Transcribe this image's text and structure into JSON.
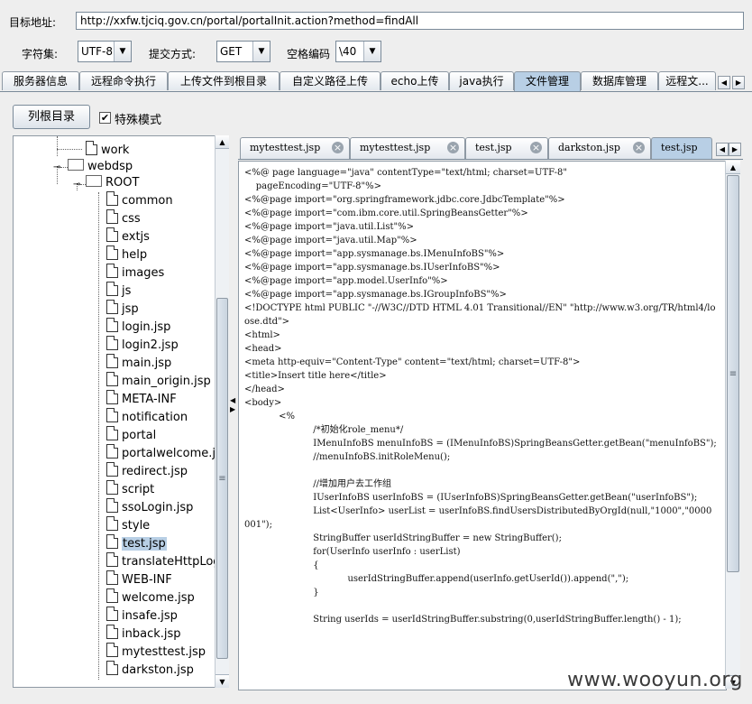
{
  "form": {
    "url_label": "目标地址:",
    "url_value": "http://xxfw.tjciq.gov.cn/portal/portalInit.action?method=findAll",
    "charset_label": "字符集:",
    "charset_value": "UTF-8",
    "submit_label": "提交方式:",
    "submit_value": "GET",
    "space_label": "空格编码",
    "space_value": "\\40"
  },
  "main_tabs": [
    {
      "label": "服务器信息"
    },
    {
      "label": "远程命令执行"
    },
    {
      "label": "上传文件到根目录"
    },
    {
      "label": "自定义路径上传"
    },
    {
      "label": "echo上传"
    },
    {
      "label": "java执行"
    },
    {
      "label": "文件管理"
    },
    {
      "label": "数据库管理"
    },
    {
      "label": "远程文..."
    }
  ],
  "toolbar": {
    "list_root_label": "列根目录",
    "special_mode_label": "特殊模式",
    "special_mode_checked": true
  },
  "tree": {
    "nodes": [
      {
        "label": "work",
        "type": "file"
      },
      {
        "label": "webdsp",
        "type": "folder"
      },
      {
        "label": "ROOT",
        "type": "folder"
      },
      {
        "label": "common",
        "type": "file"
      },
      {
        "label": "css",
        "type": "file"
      },
      {
        "label": "extjs",
        "type": "file"
      },
      {
        "label": "help",
        "type": "file"
      },
      {
        "label": "images",
        "type": "file"
      },
      {
        "label": "js",
        "type": "file"
      },
      {
        "label": "jsp",
        "type": "file"
      },
      {
        "label": "login.jsp",
        "type": "file"
      },
      {
        "label": "login2.jsp",
        "type": "file"
      },
      {
        "label": "main.jsp",
        "type": "file"
      },
      {
        "label": "main_origin.jsp",
        "type": "file"
      },
      {
        "label": "META-INF",
        "type": "file"
      },
      {
        "label": "notification",
        "type": "file"
      },
      {
        "label": "portal",
        "type": "file"
      },
      {
        "label": "portalwelcome.jsp",
        "type": "file"
      },
      {
        "label": "redirect.jsp",
        "type": "file"
      },
      {
        "label": "script",
        "type": "file"
      },
      {
        "label": "ssoLogin.jsp",
        "type": "file"
      },
      {
        "label": "style",
        "type": "file"
      },
      {
        "label": "test.jsp",
        "type": "file"
      },
      {
        "label": "translateHttpLogin",
        "type": "file"
      },
      {
        "label": "WEB-INF",
        "type": "file"
      },
      {
        "label": "welcome.jsp",
        "type": "file"
      },
      {
        "label": "insafe.jsp",
        "type": "file"
      },
      {
        "label": "inback.jsp",
        "type": "file"
      },
      {
        "label": "mytesttest.jsp",
        "type": "file"
      },
      {
        "label": "darkston.jsp",
        "type": "file"
      }
    ]
  },
  "file_tabs": [
    {
      "label": "mytesttest.jsp"
    },
    {
      "label": "mytesttest.jsp"
    },
    {
      "label": "test.jsp"
    },
    {
      "label": "darkston.jsp"
    },
    {
      "label": "test.jsp"
    }
  ],
  "editor": {
    "content": "<%@ page language=\"java\" contentType=\"text/html; charset=UTF-8\"\n    pageEncoding=\"UTF-8\"%>\n<%@page import=\"org.springframework.jdbc.core.JdbcTemplate\"%>\n<%@page import=\"com.ibm.core.util.SpringBeansGetter\"%>\n<%@page import=\"java.util.List\"%>\n<%@page import=\"java.util.Map\"%>\n<%@page import=\"app.sysmanage.bs.IMenuInfoBS\"%>\n<%@page import=\"app.sysmanage.bs.IUserInfoBS\"%>\n<%@page import=\"app.model.UserInfo\"%>\n<%@page import=\"app.sysmanage.bs.IGroupInfoBS\"%>\n<!DOCTYPE html PUBLIC \"-//W3C//DTD HTML 4.01 Transitional//EN\" \"http://www.w3.org/TR/html4/loose.dtd\">\n<html>\n<head>\n<meta http-equiv=\"Content-Type\" content=\"text/html; charset=UTF-8\">\n<title>Insert title here</title>\n</head>\n<body>\n            <%\n                        /*初始化role_menu*/\n                        IMenuInfoBS menuInfoBS = (IMenuInfoBS)SpringBeansGetter.getBean(\"menuInfoBS\");\n                        //menuInfoBS.initRoleMenu();\n\n                        //增加用户去工作组\n                        IUserInfoBS userInfoBS = (IUserInfoBS)SpringBeansGetter.getBean(\"userInfoBS\");\n                        List<UserInfo> userList = userInfoBS.findUsersDistributedByOrgId(null,\"1000\",\"0000001\");\n                        StringBuffer userIdStringBuffer = new StringBuffer();\n                        for(UserInfo userInfo : userList)\n                        {\n                                    userIdStringBuffer.append(userInfo.getUserId()).append(\",\");\n                        }\n\n                        String userIds = userIdStringBuffer.substring(0,userIdStringBuffer.length() - 1);"
  },
  "watermark": "www.wooyun.org",
  "colors": {
    "active_tab": "#b8cfe5",
    "selected_node": "#b8cfe5",
    "border": "#8e99a4"
  }
}
